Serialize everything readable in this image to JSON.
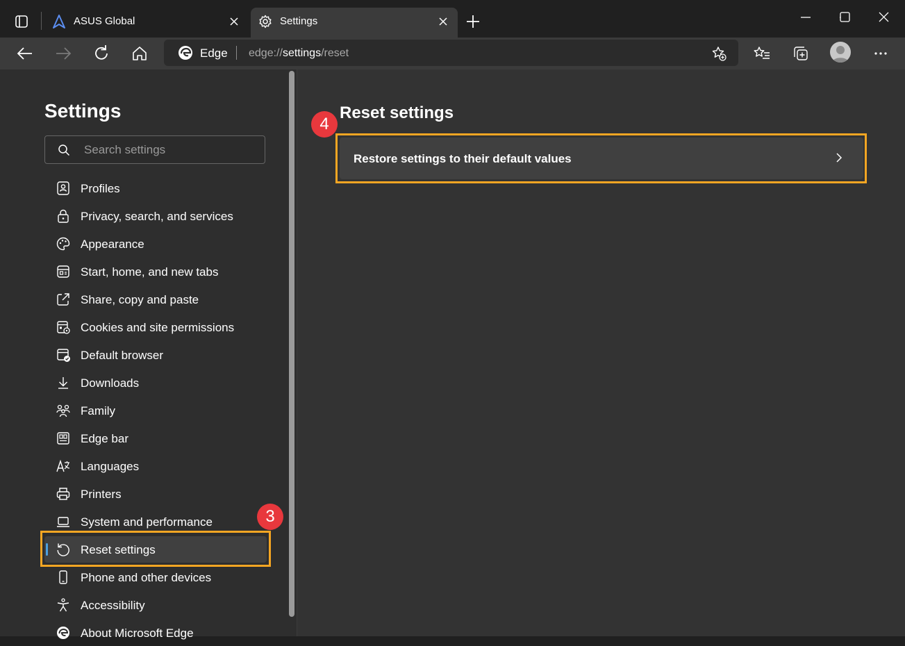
{
  "tabs": [
    {
      "title": "ASUS Global",
      "favicon": "asus-logo-icon",
      "active": false
    },
    {
      "title": "Settings",
      "favicon": "gear-icon",
      "active": true
    }
  ],
  "address_bar": {
    "site_label": "Edge",
    "url_prefix": "edge://",
    "url_path": "settings",
    "url_suffix": "/reset"
  },
  "sidebar": {
    "title": "Settings",
    "search_placeholder": "Search settings",
    "items": [
      {
        "label": "Profiles",
        "icon": "profile-card-icon"
      },
      {
        "label": "Privacy, search, and services",
        "icon": "lock-icon"
      },
      {
        "label": "Appearance",
        "icon": "palette-icon"
      },
      {
        "label": "Start, home, and new tabs",
        "icon": "home-grid-icon"
      },
      {
        "label": "Share, copy and paste",
        "icon": "share-icon"
      },
      {
        "label": "Cookies and site permissions",
        "icon": "cookie-permissions-icon"
      },
      {
        "label": "Default browser",
        "icon": "default-browser-icon"
      },
      {
        "label": "Downloads",
        "icon": "download-icon"
      },
      {
        "label": "Family",
        "icon": "family-icon"
      },
      {
        "label": "Edge bar",
        "icon": "edge-bar-icon"
      },
      {
        "label": "Languages",
        "icon": "language-icon"
      },
      {
        "label": "Printers",
        "icon": "printer-icon"
      },
      {
        "label": "System and performance",
        "icon": "laptop-icon"
      },
      {
        "label": "Reset settings",
        "icon": "reset-icon",
        "selected": true
      },
      {
        "label": "Phone and other devices",
        "icon": "phone-icon"
      },
      {
        "label": "Accessibility",
        "icon": "accessibility-icon"
      },
      {
        "label": "About Microsoft Edge",
        "icon": "edge-logo-icon"
      }
    ]
  },
  "content": {
    "title": "Reset settings",
    "restore_label": "Restore settings to their default values"
  },
  "annotations": {
    "step3": "3",
    "step4": "4",
    "highlight_color": "#f5a623",
    "badge_color": "#e8383d"
  }
}
